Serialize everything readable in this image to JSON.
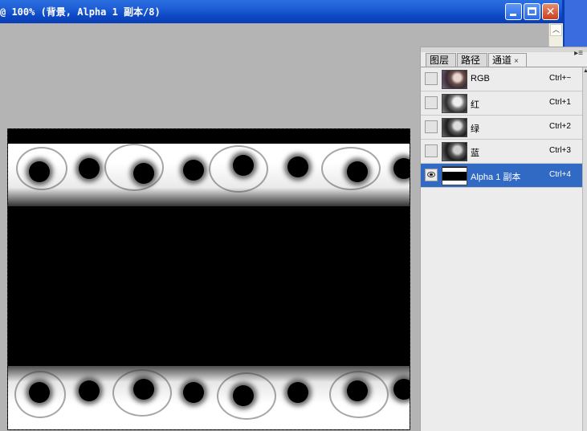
{
  "window": {
    "title": "@ 100% (背景, Alpha 1 副本/8)",
    "title_prefix_clipped": "@"
  },
  "icons": {
    "minimize": "minimize-icon",
    "maximize": "maximize-icon",
    "close": "close-icon",
    "scroll_up": "chevron-up-icon",
    "eye": "eye-icon"
  },
  "glyphs": {
    "close": "✕",
    "scroll_up": "︿",
    "panel_menu": "▸≡",
    "tab_close": "×"
  },
  "panel": {
    "tabs": [
      {
        "label": "图层",
        "active": false
      },
      {
        "label": "路径",
        "active": false
      },
      {
        "label": "通道",
        "active": true
      }
    ],
    "channels": [
      {
        "name": "RGB",
        "shortcut": "Ctrl+~",
        "visible": false,
        "selected": false,
        "thumb": "rgb"
      },
      {
        "name": "红",
        "shortcut": "Ctrl+1",
        "visible": false,
        "selected": false,
        "thumb": "red"
      },
      {
        "name": "绿",
        "shortcut": "Ctrl+2",
        "visible": false,
        "selected": false,
        "thumb": "green"
      },
      {
        "name": "蓝",
        "shortcut": "Ctrl+3",
        "visible": false,
        "selected": false,
        "thumb": "blue"
      },
      {
        "name": "Alpha 1 副本",
        "shortcut": "Ctrl+4",
        "visible": true,
        "selected": true,
        "thumb": "alpha"
      }
    ]
  },
  "colors": {
    "titlebar": "#0c47c4",
    "selection": "#316ac5",
    "workspace": "#b4b4b4"
  }
}
